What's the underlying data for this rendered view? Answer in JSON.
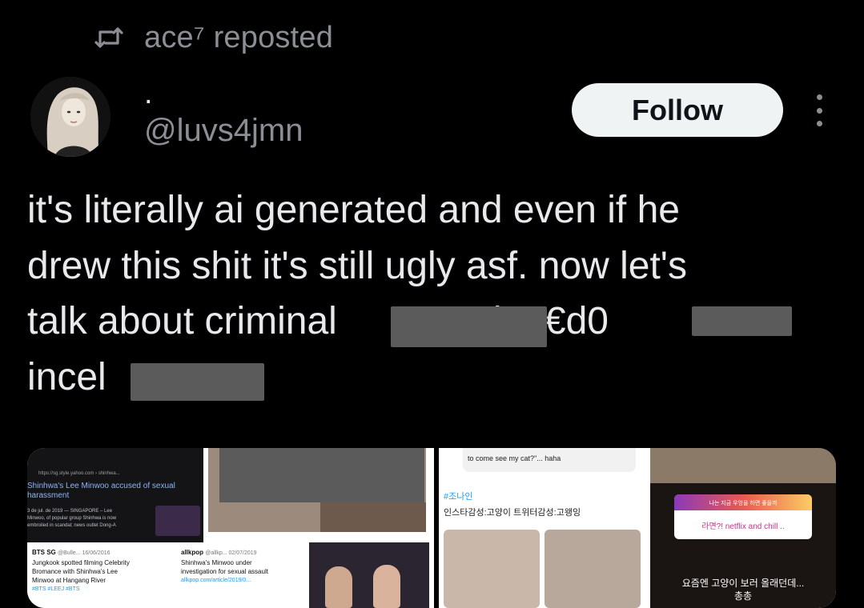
{
  "repost": {
    "label": "ace⁷ reposted",
    "icon": "repost-icon"
  },
  "author": {
    "display_name": ".",
    "handle": "@luvs4jmn",
    "avatar_icon": "avatar"
  },
  "actions": {
    "follow_label": "Follow",
    "more_icon": "more-icon"
  },
  "tweet": {
    "lines": [
      "it's literally ai generated and even if he",
      "drew this shit it's still ugly asf. now let's",
      "talk about criminal",
      "k p€d0",
      "incel"
    ]
  },
  "media": {
    "left": {
      "search_url": "https://sg.style.yahoo.com › shinhwa...",
      "search_title": "Shinhwa's Lee Minwoo accused of sexual harassment",
      "search_meta": "3 de jul. de 2019 — SINGAPORE – Lee",
      "search_snippet_1": "Minwoo, of popular group Shinhwa is now",
      "search_snippet_2": "embroiled in scandal; news outlet Dong-A",
      "card1_source": "BTS SG",
      "card1_handle": "@Bulle... 16/06/2016",
      "card1_text_1": "Jungkook spotted filming Celebrity",
      "card1_text_2": "Bromance with Shinhwa's Lee",
      "card1_text_3": "Minwoo at Hangang River",
      "card1_tags": "#BTS #LEEJ #BTS",
      "card2_source": "allkpop",
      "card2_handle": "@allkp... 02/07/2019",
      "card2_text_1": "Shinhwa's Minwoo under",
      "card2_text_2": "investigation for sexual assault",
      "card2_link": "allkpop.com/article/2019/0..."
    },
    "right": {
      "chat_text": "to come see my cat?\"... haha",
      "hashtag": "#조나인",
      "insta_line": "인스타감성:고양이  트위터감성:고왱잉",
      "story_top": "나는 지금 우엉을 하면 좋을까",
      "story_pill": "라면?! netflix and chill ..",
      "story_bottom_1": "요즘엔 고양이 보러 올래던데...",
      "story_bottom_2": "총총"
    }
  },
  "colors": {
    "background": "#000000",
    "text_primary": "#e7e9ea",
    "text_secondary": "#8b8f95",
    "follow_bg": "#eff3f4",
    "redaction": "#5b5b5b",
    "hashtag_blue": "#1d9bf0"
  }
}
